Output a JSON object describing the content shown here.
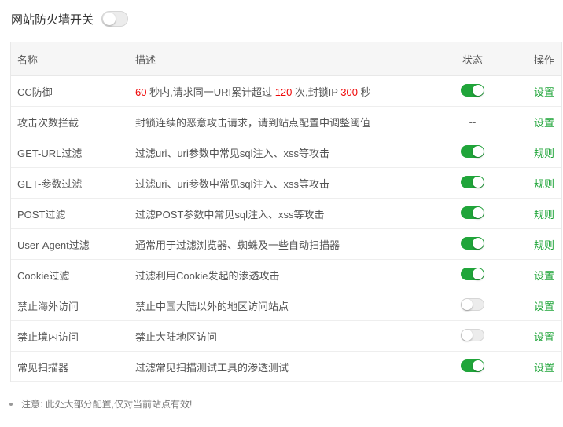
{
  "header": {
    "title": "网站防火墙开关",
    "switch_on": false
  },
  "table": {
    "columns": {
      "name": "名称",
      "desc": "描述",
      "status": "状态",
      "op": "操作"
    },
    "rows": [
      {
        "name": "CC防御",
        "desc_parts": [
          "60",
          " 秒内,请求同一URI累计超过 ",
          "120",
          " 次,封锁IP ",
          "300",
          " 秒"
        ],
        "status": "on",
        "op": "设置"
      },
      {
        "name": "攻击次数拦截",
        "desc": "封锁连续的恶意攻击请求，请到站点配置中调整阈值",
        "status": "--",
        "op": "设置"
      },
      {
        "name": "GET-URL过滤",
        "desc": "过滤uri、uri参数中常见sql注入、xss等攻击",
        "status": "on",
        "op": "规则"
      },
      {
        "name": "GET-参数过滤",
        "desc": "过滤uri、uri参数中常见sql注入、xss等攻击",
        "status": "on",
        "op": "规则"
      },
      {
        "name": "POST过滤",
        "desc": "过滤POST参数中常见sql注入、xss等攻击",
        "status": "on",
        "op": "规则"
      },
      {
        "name": "User-Agent过滤",
        "desc": "通常用于过滤浏览器、蜘蛛及一些自动扫描器",
        "status": "on",
        "op": "规则"
      },
      {
        "name": "Cookie过滤",
        "desc": "过滤利用Cookie发起的渗透攻击",
        "status": "on",
        "op": "设置"
      },
      {
        "name": "禁止海外访问",
        "desc": "禁止中国大陆以外的地区访问站点",
        "status": "off",
        "op": "设置"
      },
      {
        "name": "禁止境内访问",
        "desc": "禁止大陆地区访问",
        "status": "off",
        "op": "设置"
      },
      {
        "name": "常见扫描器",
        "desc": "过滤常见扫描测试工具的渗透测试",
        "status": "on",
        "op": "设置"
      }
    ]
  },
  "note": "注意: 此处大部分配置,仅对当前站点有效!",
  "colors": {
    "accent": "#20a53a",
    "highlight": "#ef0808"
  }
}
